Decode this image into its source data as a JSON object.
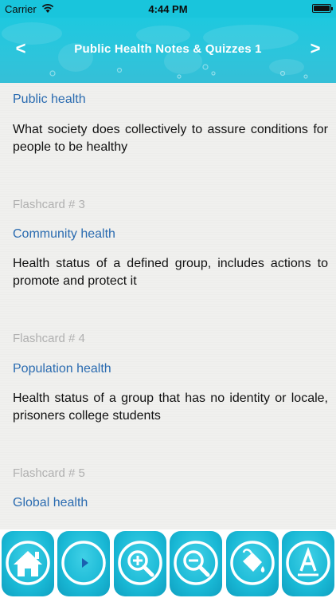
{
  "status_bar": {
    "carrier": "Carrier",
    "time": "4:44 PM"
  },
  "nav": {
    "title": "Public Health Notes & Quizzes 1",
    "back_label": "<",
    "forward_label": ">"
  },
  "cards": [
    {
      "label": "",
      "term": "Public health",
      "definition": "What society does collectively to assure conditions for people to be healthy"
    },
    {
      "label": "Flashcard # 3",
      "term": "Community health",
      "definition": "Health status of a defined group, includes actions to promote and protect it"
    },
    {
      "label": "Flashcard # 4",
      "term": "Population health",
      "definition": "Health status of a group that has no identity or locale, prisoners college students"
    },
    {
      "label": "Flashcard # 5",
      "term": "Global health",
      "definition": ""
    }
  ],
  "toolbar": {
    "buttons": [
      {
        "icon": "home-icon"
      },
      {
        "icon": "play-icon"
      },
      {
        "icon": "zoom-in-icon"
      },
      {
        "icon": "zoom-out-icon"
      },
      {
        "icon": "paint-bucket-icon"
      },
      {
        "icon": "font-icon"
      }
    ]
  },
  "colors": {
    "accent": "#19c5dc",
    "term": "#2a6bb0",
    "label": "#b0b0b0"
  }
}
